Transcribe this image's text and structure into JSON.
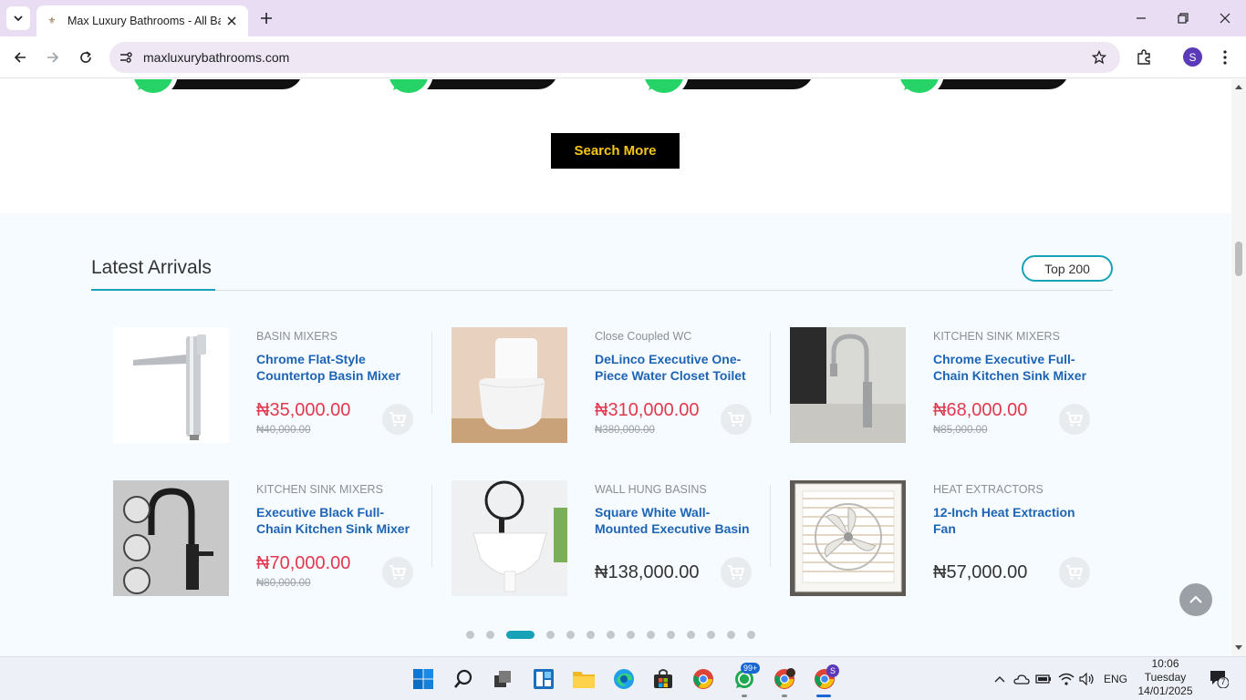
{
  "browser": {
    "tab_title": "Max Luxury Bathrooms - All Bat",
    "url": "maxluxurybathrooms.com",
    "profile_initial": "S"
  },
  "page": {
    "search_more_label": "Search More",
    "section_title": "Latest Arrivals",
    "top_badge": "Top 200",
    "products": [
      {
        "category": "BASIN MIXERS",
        "name": "Chrome Flat-Style Countertop Basin Mixer",
        "price": "₦35,000.00",
        "old_price": "₦40,000.00"
      },
      {
        "category": "Close Coupled WC",
        "name": "DeLinco Executive One-Piece Water Closet Toilet",
        "price": "₦310,000.00",
        "old_price": "₦380,000.00"
      },
      {
        "category": "KITCHEN SINK MIXERS",
        "name": "Chrome Executive Full-Chain Kitchen Sink Mixer",
        "price": "₦68,000.00",
        "old_price": "₦85,000.00"
      },
      {
        "category": "KITCHEN SINK MIXERS",
        "name": "Executive Black Full-Chain Kitchen Sink Mixer",
        "price": "₦70,000.00",
        "old_price": "₦80,000.00"
      },
      {
        "category": "WALL HUNG BASINS",
        "name": "Square White Wall-Mounted Executive Basin",
        "price": "₦138,000.00",
        "old_price": ""
      },
      {
        "category": "HEAT EXTRACTORS",
        "name": "12-Inch Heat Extraction Fan",
        "price": "₦57,000.00",
        "old_price": ""
      }
    ],
    "carousel": {
      "total": 14,
      "active_index": 2
    }
  },
  "taskbar": {
    "whatsapp_badge": "99+",
    "chrome_badge": "S",
    "language": "ENG",
    "time": "10:06",
    "day": "Tuesday",
    "date": "14/01/2025",
    "notification_count": "7"
  },
  "colors": {
    "accent": "#17a2b8",
    "sale_price": "#e0394d",
    "product_link": "#1e64b4",
    "button_bg": "#000000",
    "button_text": "#f5c518"
  }
}
